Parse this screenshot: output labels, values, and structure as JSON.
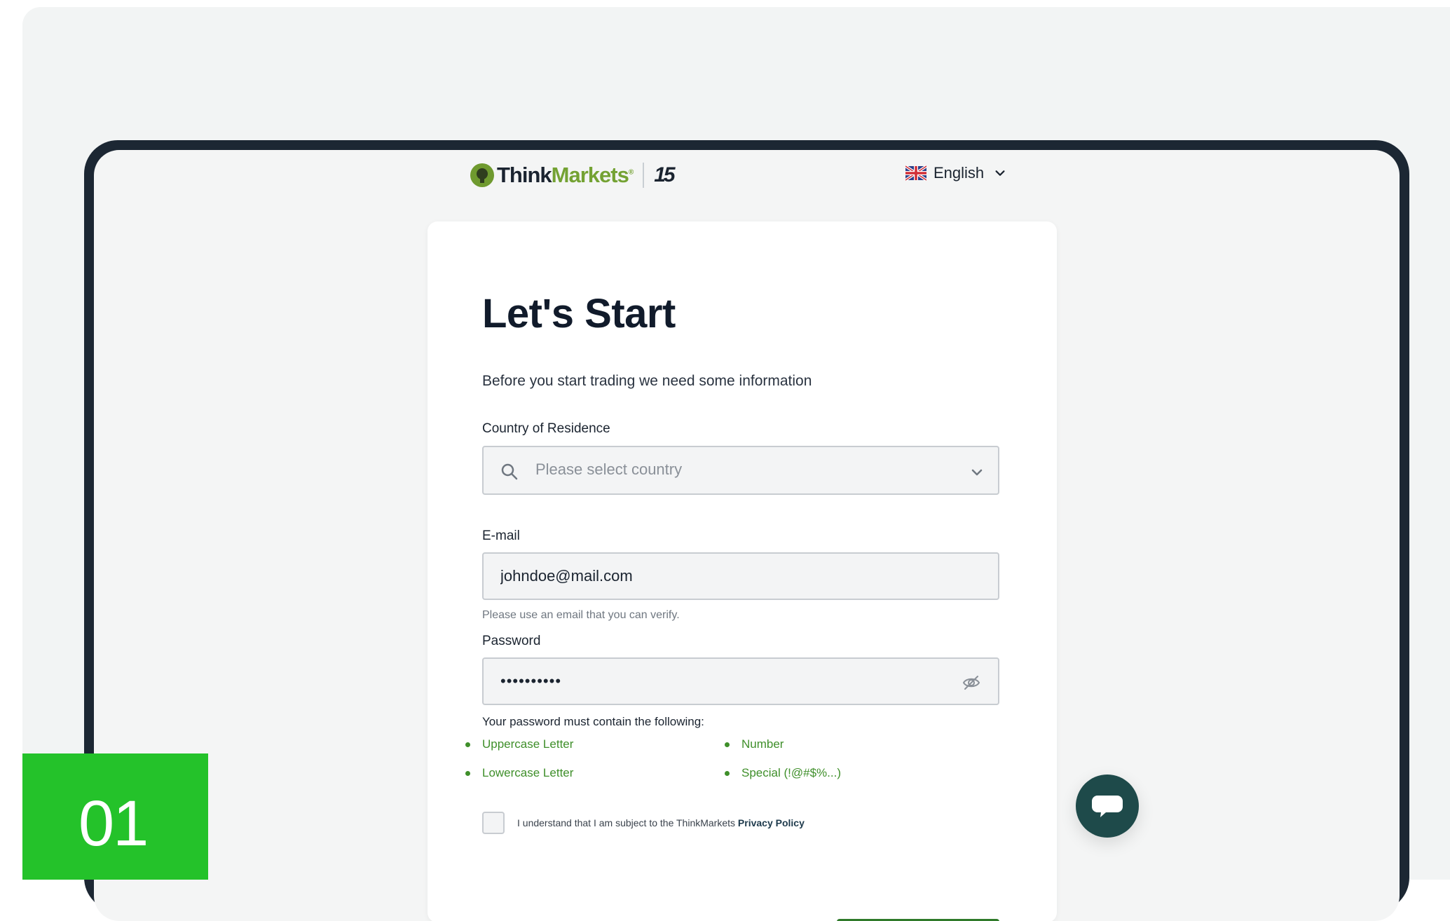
{
  "header": {
    "logo_think": "Think",
    "logo_markets": "Markets",
    "logo_reg": "®",
    "anniversary": "15",
    "language": "English"
  },
  "form": {
    "title": "Let's Start",
    "subtitle": "Before you start trading we need some information",
    "country_label": "Country of Residence",
    "country_placeholder": "Please select country",
    "email_label": "E-mail",
    "email_value": "johndoe@mail.com",
    "email_hint": "Please use an email that you can verify.",
    "password_label": "Password",
    "password_value": "••••••••••",
    "requirements_title": "Your password must contain the following:",
    "requirements": [
      "Uppercase Letter",
      "Number",
      "Lowercase Letter",
      "Special (!@#$%...)"
    ],
    "consent_text": "I understand that I am subject to the ThinkMarkets ",
    "consent_link": "Privacy Policy"
  },
  "step": "01",
  "colors": {
    "brand_green": "#74a233",
    "badge_green": "#24c22a",
    "frame": "#1c2733",
    "chat": "#1e4a4a"
  },
  "icons": [
    "search-icon",
    "chevron-down-icon",
    "eye-off-icon",
    "chat-icon",
    "uk-flag-icon"
  ]
}
